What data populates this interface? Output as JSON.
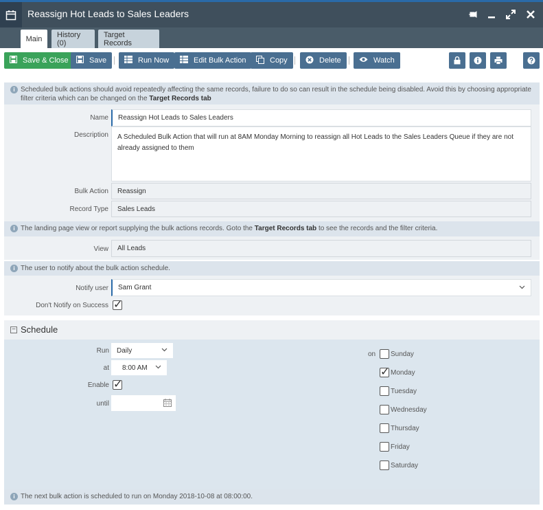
{
  "window": {
    "title": "Reassign Hot Leads to Sales Leaders",
    "icons": [
      "calendar-icon",
      "pin-icon",
      "minimize-icon",
      "maximize-icon",
      "close-icon"
    ],
    "colors": {
      "titlebar": "#3f4f5c",
      "accent": "#2a6aa8",
      "button": "#4a6f91",
      "save_close": "#3aa35a"
    }
  },
  "tabs": [
    {
      "label": "Main",
      "active": true
    },
    {
      "label": "History (0)",
      "active": false
    },
    {
      "label": "Target Records",
      "active": false
    }
  ],
  "toolbar": {
    "save_close": "Save & Close",
    "save": "Save",
    "run_now": "Run Now",
    "edit_bulk": "Edit Bulk Action",
    "copy": "Copy",
    "delete": "Delete",
    "watch": "Watch"
  },
  "info1": {
    "text": "Scheduled bulk actions should avoid repeatedly affecting the same records, failure to do so can result in the schedule being disabled. Avoid this by choosing appropriate filter criteria which can be changed on the",
    "bold": "Target Records tab"
  },
  "form": {
    "name_label": "Name",
    "name_value": "Reassign Hot Leads to Sales Leaders",
    "description_label": "Description",
    "description_value": "A Scheduled Bulk Action that will run at 8AM Monday Morning to reassign all Hot Leads to the Sales Leaders Queue if they are not already assigned to them",
    "bulk_action_label": "Bulk Action",
    "bulk_action_value": "Reassign",
    "record_type_label": "Record Type",
    "record_type_value": "Sales Leads"
  },
  "info2": {
    "text_a": "The landing page view or report supplying the bulk actions records. Goto the",
    "bold": "Target Records tab",
    "text_b": "to see the records and the filter criteria."
  },
  "view": {
    "label": "View",
    "value": "All Leads"
  },
  "info3": {
    "text": "The user to notify about the bulk action schedule."
  },
  "notify": {
    "label": "Notify user",
    "value": "Sam Grant",
    "dont_notify_label": "Don't Notify on Success",
    "dont_notify_checked": true
  },
  "schedule": {
    "title": "Schedule",
    "run_label": "Run",
    "run_value": "Daily",
    "at_label": "at",
    "at_value": "8:00 AM",
    "enable_label": "Enable",
    "enable_checked": true,
    "until_label": "until",
    "until_value": "",
    "on_label": "on",
    "days": [
      {
        "label": "Sunday",
        "checked": false
      },
      {
        "label": "Monday",
        "checked": true
      },
      {
        "label": "Tuesday",
        "checked": false
      },
      {
        "label": "Wednesday",
        "checked": false
      },
      {
        "label": "Thursday",
        "checked": false
      },
      {
        "label": "Friday",
        "checked": false
      },
      {
        "label": "Saturday",
        "checked": false
      }
    ]
  },
  "footer": {
    "text": "The next bulk action is scheduled to run on Monday 2018-10-08 at 08:00:00."
  }
}
